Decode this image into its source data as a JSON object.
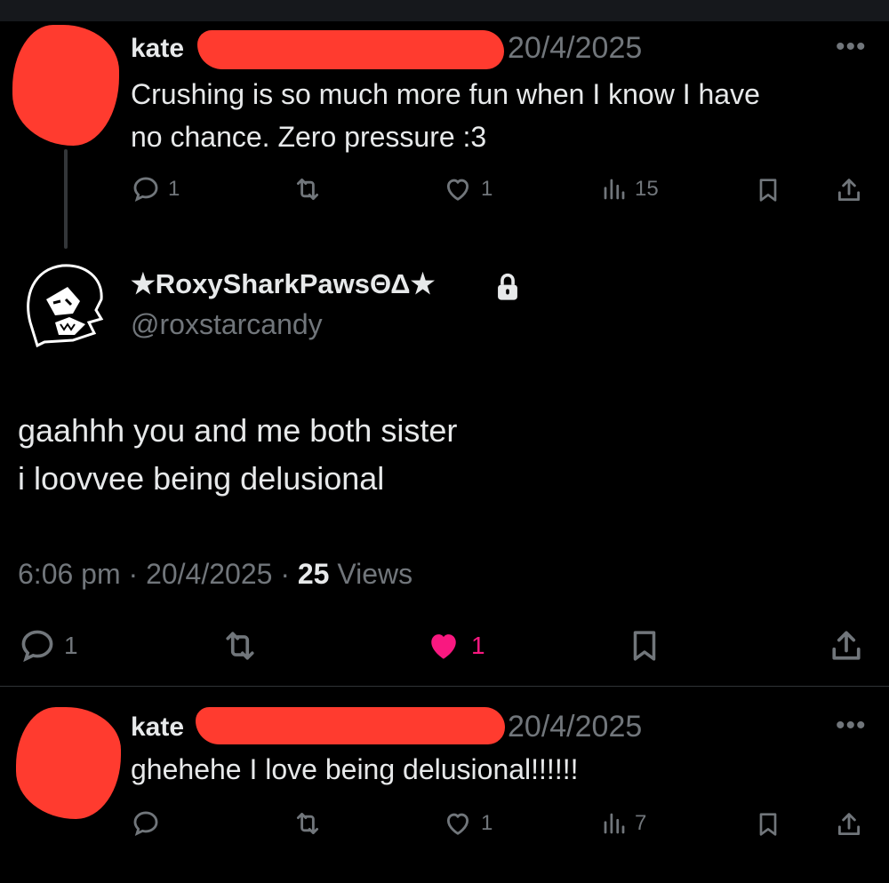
{
  "post1": {
    "name": "kate",
    "date": "20/4/2025",
    "text_line1": "Crushing is so much more fun when I know I have",
    "text_line2": "no chance. Zero pressure :3",
    "replies": "1",
    "likes": "1",
    "views": "15"
  },
  "main_post": {
    "display_name": "★RoxySharkPawsΘΔ★",
    "handle": "@roxstarcandy",
    "text_line1": "gaahhh you and me both sister",
    "text_line2": "i loovvee being delusional",
    "time": "6:06 pm",
    "date": "20/4/2025",
    "views_count": "25",
    "views_label": "Views",
    "replies": "1",
    "likes": "1",
    "like_color": "#f91880"
  },
  "post3": {
    "name": "kate",
    "date": "20/4/2025",
    "text": "ghehehe I love being delusional!!!!!!",
    "likes": "1",
    "views": "7"
  },
  "colors": {
    "background": "#000000",
    "muted": "#71767b",
    "text": "#e7e9ea",
    "redaction": "#ff3b2f"
  }
}
